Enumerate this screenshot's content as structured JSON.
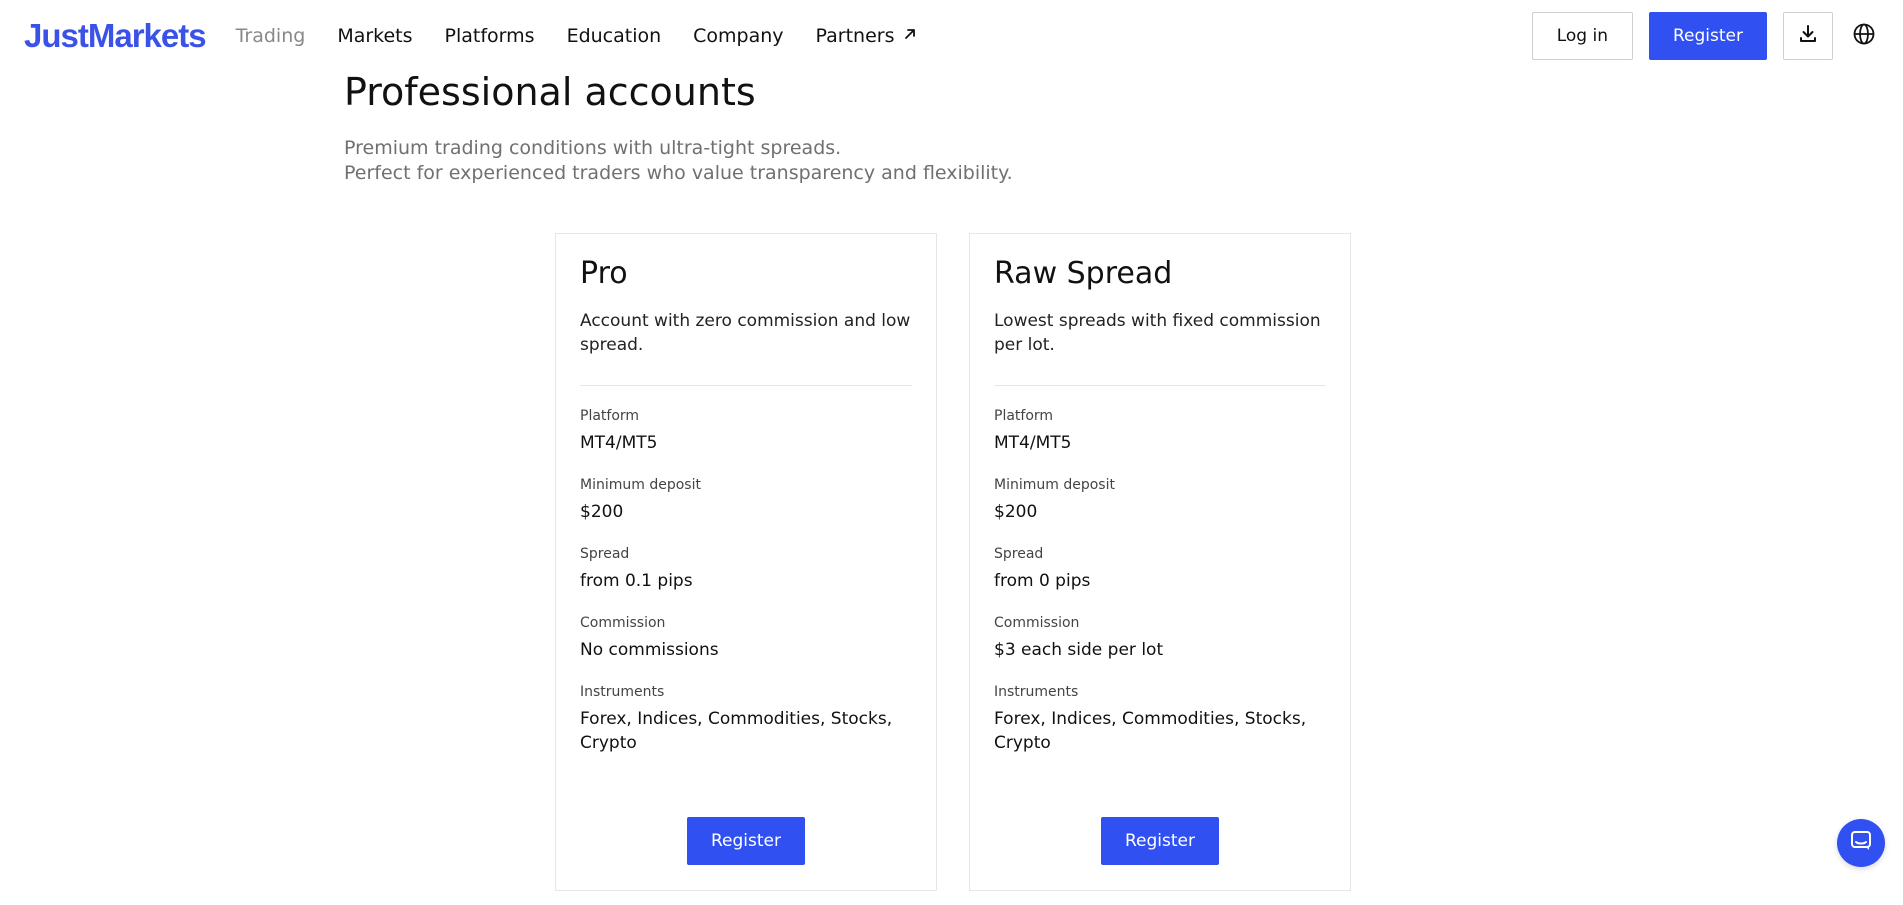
{
  "header": {
    "logo": "JustMarkets",
    "nav": [
      {
        "label": "Trading",
        "muted": true
      },
      {
        "label": "Markets"
      },
      {
        "label": "Platforms"
      },
      {
        "label": "Education"
      },
      {
        "label": "Company"
      },
      {
        "label": "Partners",
        "external": true
      }
    ],
    "login_label": "Log in",
    "register_label": "Register",
    "icons": {
      "download": "download-icon",
      "language": "globe-icon",
      "partners_ext": "arrow-up-right-icon"
    }
  },
  "section": {
    "title": "Professional accounts",
    "desc_line1": "Premium trading conditions with ultra-tight spreads.",
    "desc_line2": "Perfect for experienced traders who value transparency and flexibility."
  },
  "cards": [
    {
      "title": "Pro",
      "desc": "Account with zero commission and low spread.",
      "specs": [
        {
          "label": "Platform",
          "value": "MT4/MT5"
        },
        {
          "label": "Minimum deposit",
          "value": "$200"
        },
        {
          "label": "Spread",
          "value": "from 0.1 pips"
        },
        {
          "label": "Commission",
          "value": "No commissions"
        },
        {
          "label": "Instruments",
          "value": "Forex, Indices, Commodities, Stocks, Crypto"
        }
      ],
      "button": "Register"
    },
    {
      "title": "Raw Spread",
      "desc": "Lowest spreads with fixed commission per lot.",
      "specs": [
        {
          "label": "Platform",
          "value": "MT4/MT5"
        },
        {
          "label": "Minimum deposit",
          "value": "$200"
        },
        {
          "label": "Spread",
          "value": "from 0 pips"
        },
        {
          "label": "Commission",
          "value": "$3 each side per lot"
        },
        {
          "label": "Instruments",
          "value": "Forex, Indices, Commodities, Stocks, Crypto"
        }
      ],
      "button": "Register"
    }
  ],
  "colors": {
    "brand": "#3b52e8",
    "primary_button": "#3150f2",
    "muted_text": "#707070",
    "border": "#e6e6e6"
  },
  "chat": {
    "icon": "chat-icon"
  }
}
